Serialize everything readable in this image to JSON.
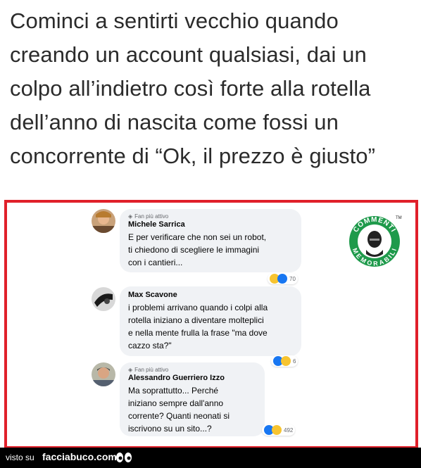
{
  "headline": "Cominci a sentirti vecchio quando creando un account qualsiasi, dai un colpo all’indietro così forte alla rotella dell’anno di nascita come fossi un concorrente di “Ok, il prezzo è giusto”",
  "logo": {
    "top_text": "COMMENTI",
    "bottom_text": "MEMORABILI",
    "tm": "TM",
    "color": "#1e9a4b"
  },
  "comments": [
    {
      "badge": "Fan più attivo",
      "name": "Michele Sarrica",
      "text": "E per verificare che non sei un robot,\nti chiedono di scegliere le immagini\ncon i cantieri...",
      "reaction_count": "70"
    },
    {
      "badge": "",
      "name": "Max Scavone",
      "text": "i problemi arrivano quando i colpi alla\nrotella iniziano a diventare molteplici\ne nella mente frulla la frase \"ma dove\ncazzo sta?\"",
      "reaction_count": "6"
    },
    {
      "badge": "Fan più attivo",
      "name": "Alessandro Guerriero Izzo",
      "text": "Ma soprattutto... Perché\niniziano sempre dall'anno\ncorrente? Quanti neonati si\niscrivono su un sito...?",
      "reaction_count": "492"
    }
  ],
  "footer": {
    "prefix": "visto su",
    "site": "facciabuco.com"
  },
  "colors": {
    "frame": "#e0202a",
    "bubble": "#f0f2f5",
    "like": "#1877f2",
    "haha": "#f7c430"
  }
}
